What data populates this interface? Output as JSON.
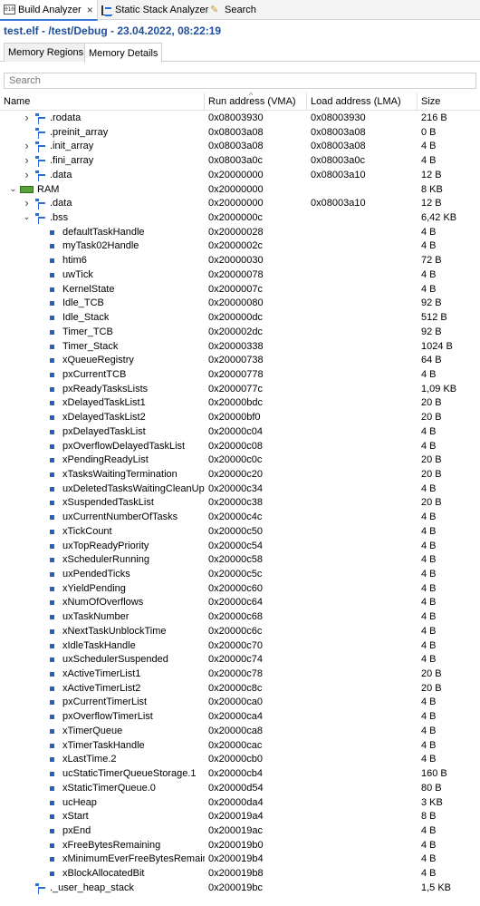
{
  "view_tabs": [
    {
      "label": "Build Analyzer",
      "icon": "build-analyzer-icon",
      "active": true,
      "close_label": "×"
    },
    {
      "label": "Static Stack Analyzer",
      "icon": "stack-analyzer-icon",
      "active": false
    },
    {
      "label": "Search",
      "icon": "search-icon",
      "active": false
    }
  ],
  "title": "test.elf - /test/Debug - 23.04.2022, 08:22:19",
  "sub_tabs": [
    {
      "label": "Memory Regions",
      "active": false
    },
    {
      "label": "Memory Details",
      "active": true
    }
  ],
  "search": {
    "placeholder": "Search",
    "value": ""
  },
  "columns": {
    "name": "Name",
    "run": "Run address (VMA)",
    "load": "Load address (LMA)",
    "size": "Size",
    "sort_indicator": "^"
  },
  "rows": [
    {
      "level": 1,
      "kind": "section",
      "toggle": "collapsed",
      "name": ".rodata",
      "run": "0x08003930",
      "load": "0x08003930",
      "size": "216 B"
    },
    {
      "level": 1,
      "kind": "section",
      "toggle": "none",
      "name": ".preinit_array",
      "run": "0x08003a08",
      "load": "0x08003a08",
      "size": "0 B"
    },
    {
      "level": 1,
      "kind": "section",
      "toggle": "collapsed",
      "name": ".init_array",
      "run": "0x08003a08",
      "load": "0x08003a08",
      "size": "4 B"
    },
    {
      "level": 1,
      "kind": "section",
      "toggle": "collapsed",
      "name": ".fini_array",
      "run": "0x08003a0c",
      "load": "0x08003a0c",
      "size": "4 B"
    },
    {
      "level": 1,
      "kind": "section",
      "toggle": "collapsed",
      "name": ".data",
      "run": "0x20000000",
      "load": "0x08003a10",
      "size": "12 B"
    },
    {
      "level": 0,
      "kind": "region",
      "toggle": "expanded",
      "name": "RAM",
      "run": "0x20000000",
      "load": "",
      "size": "8 KB"
    },
    {
      "level": 1,
      "kind": "section",
      "toggle": "collapsed",
      "name": ".data",
      "run": "0x20000000",
      "load": "0x08003a10",
      "size": "12 B"
    },
    {
      "level": 1,
      "kind": "section",
      "toggle": "expanded",
      "name": ".bss",
      "run": "0x2000000c",
      "load": "",
      "size": "6,42 KB"
    },
    {
      "level": 2,
      "kind": "symbol",
      "toggle": "none",
      "name": "defaultTaskHandle",
      "run": "0x20000028",
      "load": "",
      "size": "4 B"
    },
    {
      "level": 2,
      "kind": "symbol",
      "toggle": "none",
      "name": "myTask02Handle",
      "run": "0x2000002c",
      "load": "",
      "size": "4 B"
    },
    {
      "level": 2,
      "kind": "symbol",
      "toggle": "none",
      "name": "htim6",
      "run": "0x20000030",
      "load": "",
      "size": "72 B"
    },
    {
      "level": 2,
      "kind": "symbol",
      "toggle": "none",
      "name": "uwTick",
      "run": "0x20000078",
      "load": "",
      "size": "4 B"
    },
    {
      "level": 2,
      "kind": "symbol",
      "toggle": "none",
      "name": "KernelState",
      "run": "0x2000007c",
      "load": "",
      "size": "4 B"
    },
    {
      "level": 2,
      "kind": "symbol",
      "toggle": "none",
      "name": "Idle_TCB",
      "run": "0x20000080",
      "load": "",
      "size": "92 B"
    },
    {
      "level": 2,
      "kind": "symbol",
      "toggle": "none",
      "name": "Idle_Stack",
      "run": "0x200000dc",
      "load": "",
      "size": "512 B"
    },
    {
      "level": 2,
      "kind": "symbol",
      "toggle": "none",
      "name": "Timer_TCB",
      "run": "0x200002dc",
      "load": "",
      "size": "92 B"
    },
    {
      "level": 2,
      "kind": "symbol",
      "toggle": "none",
      "name": "Timer_Stack",
      "run": "0x20000338",
      "load": "",
      "size": "1024 B"
    },
    {
      "level": 2,
      "kind": "symbol",
      "toggle": "none",
      "name": "xQueueRegistry",
      "run": "0x20000738",
      "load": "",
      "size": "64 B"
    },
    {
      "level": 2,
      "kind": "symbol",
      "toggle": "none",
      "name": "pxCurrentTCB",
      "run": "0x20000778",
      "load": "",
      "size": "4 B"
    },
    {
      "level": 2,
      "kind": "symbol",
      "toggle": "none",
      "name": "pxReadyTasksLists",
      "run": "0x2000077c",
      "load": "",
      "size": "1,09 KB"
    },
    {
      "level": 2,
      "kind": "symbol",
      "toggle": "none",
      "name": "xDelayedTaskList1",
      "run": "0x20000bdc",
      "load": "",
      "size": "20 B"
    },
    {
      "level": 2,
      "kind": "symbol",
      "toggle": "none",
      "name": "xDelayedTaskList2",
      "run": "0x20000bf0",
      "load": "",
      "size": "20 B"
    },
    {
      "level": 2,
      "kind": "symbol",
      "toggle": "none",
      "name": "pxDelayedTaskList",
      "run": "0x20000c04",
      "load": "",
      "size": "4 B"
    },
    {
      "level": 2,
      "kind": "symbol",
      "toggle": "none",
      "name": "pxOverflowDelayedTaskList",
      "run": "0x20000c08",
      "load": "",
      "size": "4 B"
    },
    {
      "level": 2,
      "kind": "symbol",
      "toggle": "none",
      "name": "xPendingReadyList",
      "run": "0x20000c0c",
      "load": "",
      "size": "20 B"
    },
    {
      "level": 2,
      "kind": "symbol",
      "toggle": "none",
      "name": "xTasksWaitingTermination",
      "run": "0x20000c20",
      "load": "",
      "size": "20 B"
    },
    {
      "level": 2,
      "kind": "symbol",
      "toggle": "none",
      "name": "uxDeletedTasksWaitingCleanUp",
      "run": "0x20000c34",
      "load": "",
      "size": "4 B"
    },
    {
      "level": 2,
      "kind": "symbol",
      "toggle": "none",
      "name": "xSuspendedTaskList",
      "run": "0x20000c38",
      "load": "",
      "size": "20 B"
    },
    {
      "level": 2,
      "kind": "symbol",
      "toggle": "none",
      "name": "uxCurrentNumberOfTasks",
      "run": "0x20000c4c",
      "load": "",
      "size": "4 B"
    },
    {
      "level": 2,
      "kind": "symbol",
      "toggle": "none",
      "name": "xTickCount",
      "run": "0x20000c50",
      "load": "",
      "size": "4 B"
    },
    {
      "level": 2,
      "kind": "symbol",
      "toggle": "none",
      "name": "uxTopReadyPriority",
      "run": "0x20000c54",
      "load": "",
      "size": "4 B"
    },
    {
      "level": 2,
      "kind": "symbol",
      "toggle": "none",
      "name": "xSchedulerRunning",
      "run": "0x20000c58",
      "load": "",
      "size": "4 B"
    },
    {
      "level": 2,
      "kind": "symbol",
      "toggle": "none",
      "name": "uxPendedTicks",
      "run": "0x20000c5c",
      "load": "",
      "size": "4 B"
    },
    {
      "level": 2,
      "kind": "symbol",
      "toggle": "none",
      "name": "xYieldPending",
      "run": "0x20000c60",
      "load": "",
      "size": "4 B"
    },
    {
      "level": 2,
      "kind": "symbol",
      "toggle": "none",
      "name": "xNumOfOverflows",
      "run": "0x20000c64",
      "load": "",
      "size": "4 B"
    },
    {
      "level": 2,
      "kind": "symbol",
      "toggle": "none",
      "name": "uxTaskNumber",
      "run": "0x20000c68",
      "load": "",
      "size": "4 B"
    },
    {
      "level": 2,
      "kind": "symbol",
      "toggle": "none",
      "name": "xNextTaskUnblockTime",
      "run": "0x20000c6c",
      "load": "",
      "size": "4 B"
    },
    {
      "level": 2,
      "kind": "symbol",
      "toggle": "none",
      "name": "xIdleTaskHandle",
      "run": "0x20000c70",
      "load": "",
      "size": "4 B"
    },
    {
      "level": 2,
      "kind": "symbol",
      "toggle": "none",
      "name": "uxSchedulerSuspended",
      "run": "0x20000c74",
      "load": "",
      "size": "4 B"
    },
    {
      "level": 2,
      "kind": "symbol",
      "toggle": "none",
      "name": "xActiveTimerList1",
      "run": "0x20000c78",
      "load": "",
      "size": "20 B"
    },
    {
      "level": 2,
      "kind": "symbol",
      "toggle": "none",
      "name": "xActiveTimerList2",
      "run": "0x20000c8c",
      "load": "",
      "size": "20 B"
    },
    {
      "level": 2,
      "kind": "symbol",
      "toggle": "none",
      "name": "pxCurrentTimerList",
      "run": "0x20000ca0",
      "load": "",
      "size": "4 B"
    },
    {
      "level": 2,
      "kind": "symbol",
      "toggle": "none",
      "name": "pxOverflowTimerList",
      "run": "0x20000ca4",
      "load": "",
      "size": "4 B"
    },
    {
      "level": 2,
      "kind": "symbol",
      "toggle": "none",
      "name": "xTimerQueue",
      "run": "0x20000ca8",
      "load": "",
      "size": "4 B"
    },
    {
      "level": 2,
      "kind": "symbol",
      "toggle": "none",
      "name": "xTimerTaskHandle",
      "run": "0x20000cac",
      "load": "",
      "size": "4 B"
    },
    {
      "level": 2,
      "kind": "symbol",
      "toggle": "none",
      "name": "xLastTime.2",
      "run": "0x20000cb0",
      "load": "",
      "size": "4 B"
    },
    {
      "level": 2,
      "kind": "symbol",
      "toggle": "none",
      "name": "ucStaticTimerQueueStorage.1",
      "run": "0x20000cb4",
      "load": "",
      "size": "160 B"
    },
    {
      "level": 2,
      "kind": "symbol",
      "toggle": "none",
      "name": "xStaticTimerQueue.0",
      "run": "0x20000d54",
      "load": "",
      "size": "80 B"
    },
    {
      "level": 2,
      "kind": "symbol",
      "toggle": "none",
      "name": "ucHeap",
      "run": "0x20000da4",
      "load": "",
      "size": "3 KB"
    },
    {
      "level": 2,
      "kind": "symbol",
      "toggle": "none",
      "name": "xStart",
      "run": "0x200019a4",
      "load": "",
      "size": "8 B"
    },
    {
      "level": 2,
      "kind": "symbol",
      "toggle": "none",
      "name": "pxEnd",
      "run": "0x200019ac",
      "load": "",
      "size": "4 B"
    },
    {
      "level": 2,
      "kind": "symbol",
      "toggle": "none",
      "name": "xFreeBytesRemaining",
      "run": "0x200019b0",
      "load": "",
      "size": "4 B"
    },
    {
      "level": 2,
      "kind": "symbol",
      "toggle": "none",
      "name": "xMinimumEverFreeBytesRemaining",
      "run": "0x200019b4",
      "load": "",
      "size": "4 B"
    },
    {
      "level": 2,
      "kind": "symbol",
      "toggle": "none",
      "name": "xBlockAllocatedBit",
      "run": "0x200019b8",
      "load": "",
      "size": "4 B"
    },
    {
      "level": 1,
      "kind": "section",
      "toggle": "none",
      "name": "._user_heap_stack",
      "run": "0x200019bc",
      "load": "",
      "size": "1,5 KB"
    }
  ]
}
